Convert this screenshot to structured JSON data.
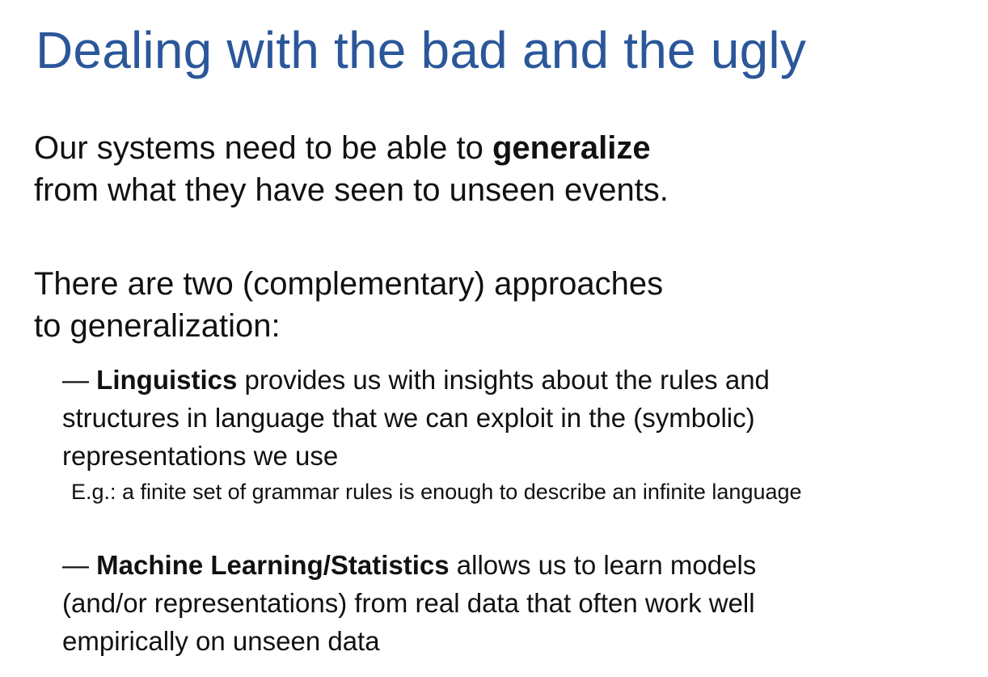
{
  "slide": {
    "title": "Dealing with the bad and the ugly",
    "intro": {
      "line1_pre": "Our systems need to be able to ",
      "line1_bold": "generalize",
      "line2": "from what they have seen to unseen events."
    },
    "approaches": {
      "line1": "There are two (complementary) approaches",
      "line2": "to generalization:"
    },
    "bullet_linguistics": {
      "dash": "— ",
      "bold": "Linguistics",
      "line1_rest": " provides us with insights about the rules and",
      "line2": "structures in language that we can exploit in the (symbolic)",
      "line3": "representations we use"
    },
    "example": "E.g.: a finite set of grammar rules is enough to describe an infinite language",
    "bullet_ml": {
      "dash": "— ",
      "bold": "Machine Learning/Statistics",
      "line1_rest": " allows us to learn models",
      "line2": "(and/or representations) from real data that often work well",
      "line3": "empirically on unseen data"
    }
  }
}
